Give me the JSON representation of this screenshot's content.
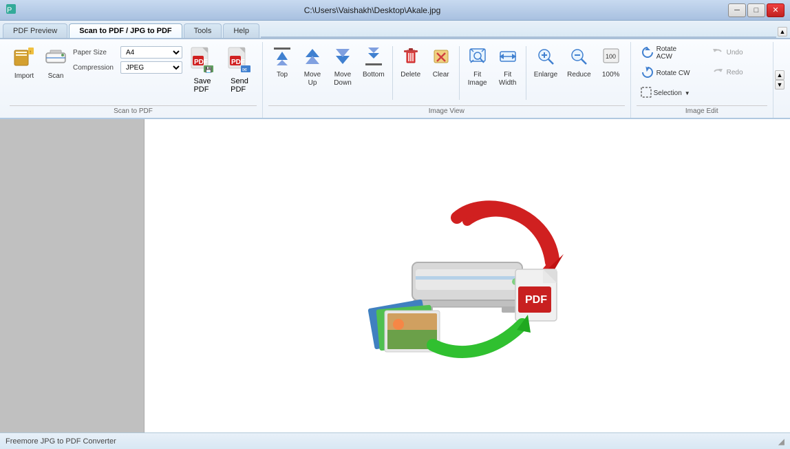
{
  "titleBar": {
    "title": "C:\\Users\\Vaishakh\\Desktop\\Akale.jpg",
    "appIcon": "🖨️",
    "minimize": "─",
    "maximize": "□",
    "close": "✕"
  },
  "menuBar": {
    "items": [
      "PDF Preview",
      "Scan to PDF / JPG to PDF",
      "Tools",
      "Help"
    ],
    "activeIndex": 1
  },
  "ribbon": {
    "scanToPdf": {
      "label": "Scan to PDF",
      "paperSizeLabel": "Paper Size",
      "paperSizeValue": "A4",
      "compressionLabel": "Compression",
      "compressionValue": "JPEG",
      "import": {
        "label": "Import",
        "icon": "📂"
      },
      "scan": {
        "label": "Scan",
        "icon": "🖨️"
      },
      "savePdf": {
        "label": "Save\nPDF",
        "icon": "📄"
      },
      "sendPdf": {
        "label": "Send\nPDF",
        "icon": "📧"
      }
    },
    "imageView": {
      "label": "Image View",
      "top": {
        "label": "Top",
        "icon": "⏫"
      },
      "moveUp": {
        "label": "Move\nUp",
        "icon": "🔼"
      },
      "moveDown": {
        "label": "Move\nDown",
        "icon": "🔽"
      },
      "bottom": {
        "label": "Bottom",
        "icon": "⏬"
      },
      "delete": {
        "label": "Delete",
        "icon": "❌"
      },
      "clear": {
        "label": "Clear",
        "icon": "🗑️"
      },
      "fitImage": {
        "label": "Fit\nImage",
        "icon": "🔍"
      },
      "fitWidth": {
        "label": "Fit\nWidth",
        "icon": "↔️"
      },
      "enlarge": {
        "label": "Enlarge",
        "icon": "🔍"
      },
      "reduce": {
        "label": "Reduce",
        "icon": "🔍"
      },
      "zoom": {
        "label": "100%",
        "icon": ""
      }
    },
    "imageEdit": {
      "label": "Image Edit",
      "rotateAcw": {
        "label": "Rotate ACW",
        "icon": "↺"
      },
      "rotateCw": {
        "label": "Rotate CW",
        "icon": "↻"
      },
      "selection": {
        "label": "Selection",
        "icon": "⬚"
      },
      "undo": {
        "label": "Undo",
        "icon": "↩"
      },
      "redo": {
        "label": "Redo",
        "icon": "↪"
      }
    }
  },
  "statusBar": {
    "text": "Freemore JPG to PDF Converter"
  }
}
